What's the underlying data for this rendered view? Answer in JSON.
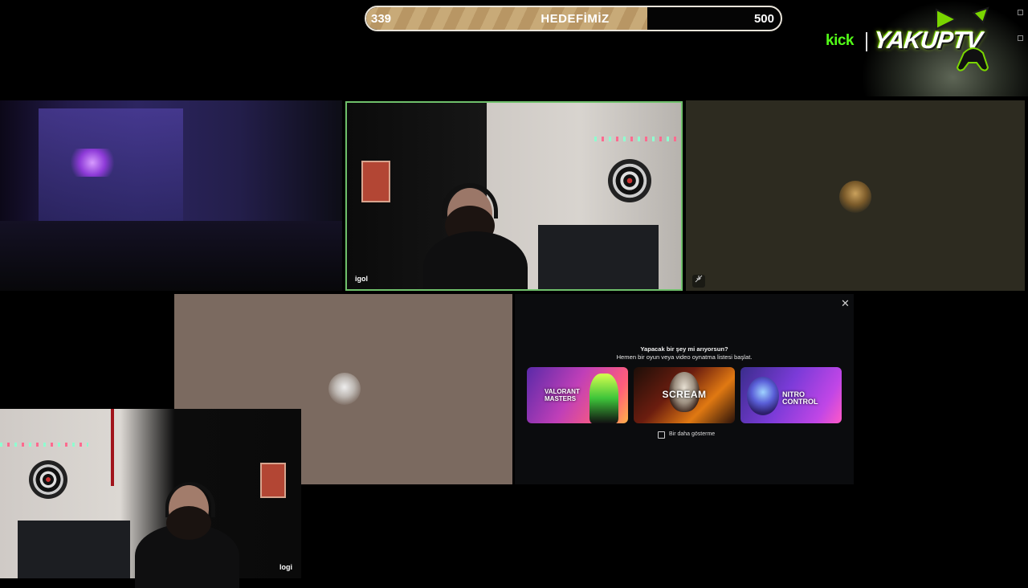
{
  "goal": {
    "current": "339",
    "title": "HEDEFİMİZ",
    "max": "500",
    "progress": 0.678
  },
  "branding": {
    "platform": "kick",
    "channel": "YAKUPTV",
    "platform_color": "#53fc18"
  },
  "tiles": {
    "main_cam_tag": "igol",
    "pip_cam_tag": "logi",
    "active_speaker_color": "#6fc06b"
  },
  "activity_panel": {
    "title": "Yapacak bir şey mi arıyorsun?",
    "subtitle": "Hemen bir oyun veya video oynatma listesi başlat.",
    "cards": [
      {
        "label": "VALORANT MASTERS"
      },
      {
        "label": "SCREAM"
      },
      {
        "label": "NITRO CONTROL"
      }
    ],
    "dont_show_again": "Bir daha gösterme"
  },
  "icons": [
    "close-icon",
    "mic-muted-icon",
    "checkbox-icon"
  ]
}
